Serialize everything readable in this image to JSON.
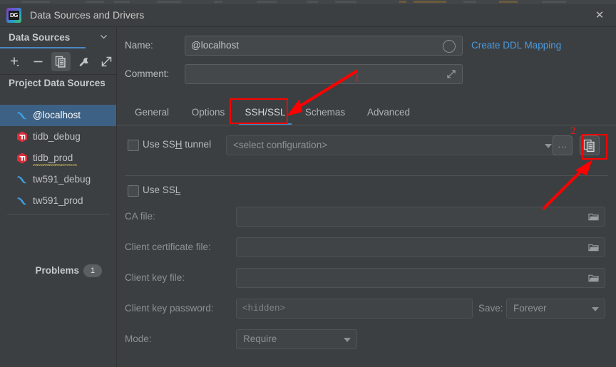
{
  "window": {
    "title": "Data Sources and Drivers",
    "app_icon": "datagrip-logo-icon",
    "logo_text": "DG",
    "close_label": "✕"
  },
  "sidebar": {
    "header": {
      "label": "Data Sources",
      "chevron": "chevron-down-icon"
    },
    "toolbar": [
      {
        "name": "add-data-source-button",
        "icon": "plus-dropdown-icon",
        "selected": false
      },
      {
        "name": "remove-data-source-button",
        "icon": "minus-icon",
        "selected": false
      },
      {
        "name": "duplicate-data-source-button",
        "icon": "copy-icon",
        "selected": true
      },
      {
        "name": "properties-button",
        "icon": "wrench-icon",
        "selected": false
      },
      {
        "name": "jump-to-console-button",
        "icon": "external-link-icon",
        "selected": false
      }
    ],
    "section_title": "Project Data Sources",
    "items": [
      {
        "label": "@localhost",
        "icon": "mysql-dolphin-icon",
        "selected": true,
        "warning": false
      },
      {
        "label": "tidb_debug",
        "icon": "tidb-icon",
        "selected": false,
        "warning": false
      },
      {
        "label": "tidb_prod",
        "icon": "tidb-icon",
        "selected": false,
        "warning": true
      },
      {
        "label": "tw591_debug",
        "icon": "mysql-dolphin-icon",
        "selected": false,
        "warning": false
      },
      {
        "label": "tw591_prod",
        "icon": "mysql-dolphin-icon",
        "selected": false,
        "warning": false
      }
    ],
    "problems": {
      "label": "Problems",
      "count": "1"
    }
  },
  "form": {
    "name_label": "Name:",
    "name_value": "@localhost",
    "name_color_indicator": "color-circle-icon",
    "create_ddl_mapping": "Create DDL Mapping",
    "comment_label": "Comment:",
    "comment_value": "",
    "comment_expand_icon": "expand-icon"
  },
  "tabs": [
    {
      "label": "General",
      "active": false
    },
    {
      "label": "Options",
      "active": false
    },
    {
      "label": "SSH/SSL",
      "active": true
    },
    {
      "label": "Schemas",
      "active": false
    },
    {
      "label": "Advanced",
      "active": false
    }
  ],
  "ssh": {
    "checkbox_label_pre": "Use SS",
    "checkbox_label_mnemonic": "H",
    "checkbox_label_post": " tunnel",
    "checked": false,
    "config_placeholder": "<select configuration>",
    "browse_button_label": "...",
    "duplicate_button_icon": "copy-icon"
  },
  "ssl": {
    "checkbox_label_pre": "Use SS",
    "checkbox_label_mnemonic": "L",
    "checkbox_label_post": "",
    "checked": false,
    "fields": [
      {
        "label": "CA file:",
        "value": "",
        "icon": "folder-icon"
      },
      {
        "label": "Client certificate file:",
        "value": "",
        "icon": "folder-icon"
      },
      {
        "label": "Client key file:",
        "value": "",
        "icon": "folder-icon"
      }
    ],
    "key_password_label": "Client key password:",
    "key_password_placeholder": "<hidden>",
    "save_label": "Save:",
    "save_value": "Forever",
    "mode_label": "Mode:",
    "mode_value": "Require"
  },
  "annotations": [
    {
      "number": "1",
      "target": "ssh-ssl-tab"
    },
    {
      "number": "2",
      "target": "ssh-duplicate-config-button"
    }
  ],
  "colors": {
    "accent_blue": "#4a88c7",
    "link_blue": "#4a9ae0",
    "selection_blue": "#3d6185",
    "annotation_red": "#ff0000",
    "panel_bg": "#3c3f41",
    "field_bg": "#45484a",
    "tidb_red": "#dc2f3c",
    "mysql_blue": "#2f9bd8"
  }
}
